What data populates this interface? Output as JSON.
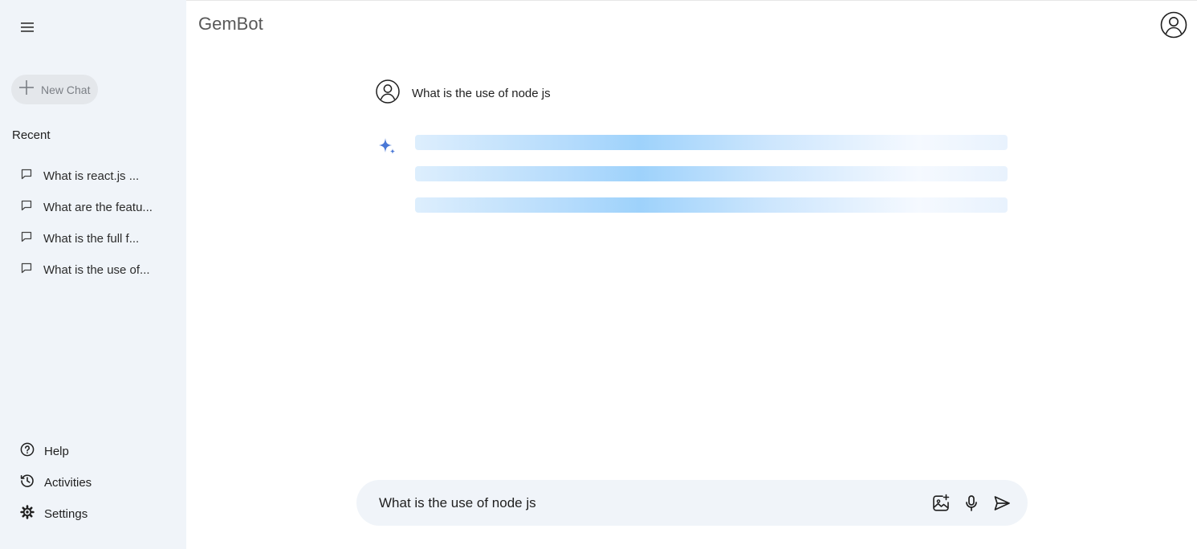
{
  "app": {
    "title": "GemBot"
  },
  "sidebar": {
    "new_chat_label": "New Chat",
    "recent_title": "Recent",
    "recent_items": [
      {
        "label": "What is react.js ..."
      },
      {
        "label": "What are the featu..."
      },
      {
        "label": "What is the full f..."
      },
      {
        "label": "What is the use of..."
      }
    ],
    "bottom_items": [
      {
        "label": "Help",
        "icon": "help-icon"
      },
      {
        "label": "Activities",
        "icon": "history-icon"
      },
      {
        "label": "Settings",
        "icon": "gear-icon"
      }
    ]
  },
  "chat": {
    "question": "What is the use of node js",
    "status": "loading"
  },
  "input": {
    "value": "What is the use of node js"
  },
  "colors": {
    "sidebar_bg": "#f0f4f9",
    "loader_blue": "#9ed2fb",
    "gem_blue": "#4a78d6"
  }
}
